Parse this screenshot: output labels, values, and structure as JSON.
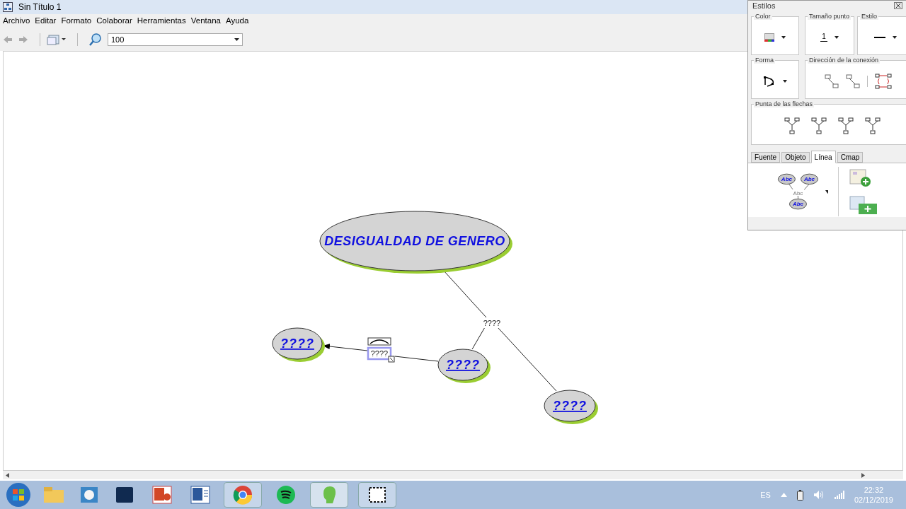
{
  "window": {
    "title": "Sin Título 1"
  },
  "menu": [
    "Archivo",
    "Editar",
    "Formato",
    "Colaborar",
    "Herramientas",
    "Ventana",
    "Ayuda"
  ],
  "toolbar": {
    "zoom": "100"
  },
  "concept_map": {
    "nodes": [
      {
        "label": "DESIGUALDAD DE GENERO",
        "kind": "main"
      },
      {
        "label": "????",
        "kind": "concept"
      },
      {
        "label": "????",
        "kind": "concept"
      },
      {
        "label": "????",
        "kind": "concept"
      }
    ],
    "links": [
      {
        "label": "????",
        "selected": false
      },
      {
        "label": "????",
        "selected": true
      }
    ]
  },
  "styles_panel": {
    "title": "Estilos",
    "groups": [
      {
        "label": "Color"
      },
      {
        "label": "Tamaño punto",
        "value": "1"
      },
      {
        "label": "Estilo"
      },
      {
        "label": "Forma"
      },
      {
        "label": "Dirección de la conexión"
      },
      {
        "label": "Punta de las flechas"
      }
    ],
    "tabs": [
      {
        "label": "Fuente",
        "selected": false
      },
      {
        "label": "Objeto",
        "selected": false
      },
      {
        "label": "Línea",
        "selected": true
      },
      {
        "label": "Cmap",
        "selected": false
      }
    ],
    "preview_labels": [
      "Abc",
      "Abc",
      "Abc",
      "Abc"
    ]
  },
  "taskbar": {
    "language": "ES",
    "time": "22:32",
    "date": "02/12/2019"
  }
}
